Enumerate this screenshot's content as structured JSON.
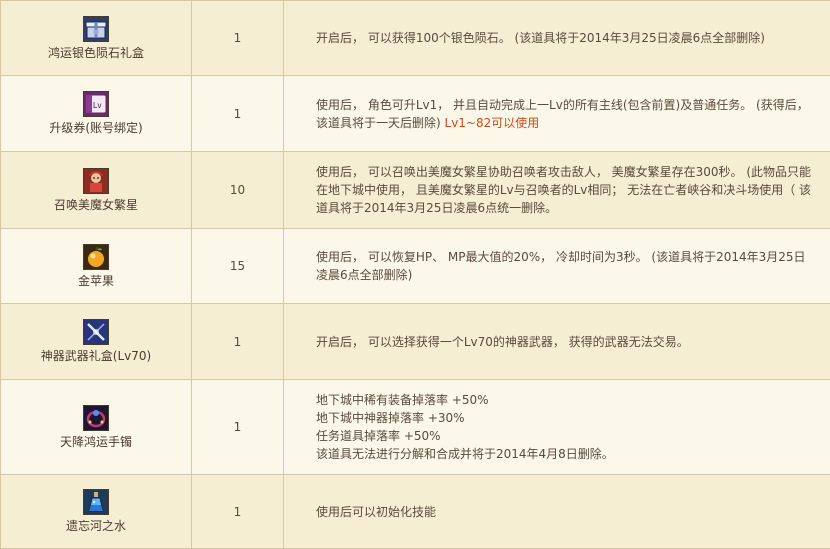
{
  "rows": [
    {
      "name": "鸿运银色陨石礼盒",
      "qty": "1",
      "icon": "gift-box-icon",
      "desc": "开启后， 可以获得100个银色陨石。 (该道具将于2014年3月25日凌晨6点全部删除)"
    },
    {
      "name": "升级券(账号绑定)",
      "qty": "1",
      "icon": "level-ticket-icon",
      "icon_text": "Lv",
      "desc": "使用后， 角色可升Lv1， 并且自动完成上一Lv的所有主线(包含前置)及普通任务。 (获得后，该道具将于一天后删除)",
      "desc_red": " Lv1~82可以使用"
    },
    {
      "name": "召唤美魔女繁星",
      "qty": "10",
      "icon": "summon-character-icon",
      "desc": "使用后， 可以召唤出美魔女繁星协助召唤者攻击敌人， 美魔女繁星存在300秒。 (此物品只能在地下城中使用， 且美魔女繁星的Lv与召唤者的Lv相同； 无法在亡者峡谷和决斗场使用（ 该道具将于2014年3月25日凌晨6点统一删除。"
    },
    {
      "name": "金苹果",
      "qty": "15",
      "icon": "golden-apple-icon",
      "desc": "使用后， 可以恢复HP、 MP最大值的20%， 冷却时间为3秒。 (该道具将于2014年3月25日凌晨6点全部删除)"
    },
    {
      "name": "神器武器礼盒(Lv70)",
      "qty": "1",
      "icon": "weapon-box-icon",
      "desc": "开启后， 可以选择获得一个Lv70的神器武器， 获得的武器无法交易。"
    },
    {
      "name": "天降鸿运手镯",
      "qty": "1",
      "icon": "bracelet-icon",
      "desc_lines": [
        "地下城中稀有装备掉落率 +50%",
        "地下城中神器掉落率 +30%",
        "任务道具掉落率 +50%",
        "该道具无法进行分解和合成并将于2014年4月8日删除。"
      ]
    },
    {
      "name": "遗忘河之水",
      "qty": "1",
      "icon": "potion-bottle-icon",
      "desc": "使用后可以初始化技能"
    }
  ],
  "colors": {
    "bg_odd": "#f5eed3",
    "bg_even": "#fbf8ea",
    "border": "#d6c9a1",
    "text": "#5a4a3a",
    "highlight": "#d04a17"
  }
}
